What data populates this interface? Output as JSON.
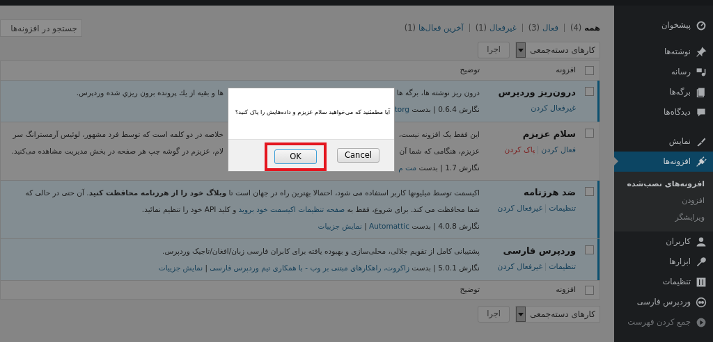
{
  "sidebar": {
    "items": [
      {
        "label": "پیشخوان",
        "selected": false
      },
      {
        "label": "نوشته‌ها",
        "selected": false
      },
      {
        "label": "رسانه",
        "selected": false
      },
      {
        "label": "برگه‌ها",
        "selected": false
      },
      {
        "label": "دیدگاه‌ها",
        "selected": false
      },
      {
        "label": "نمایش",
        "selected": false
      },
      {
        "label": "افزونه‌ها",
        "selected": true,
        "children": [
          {
            "label": "افزونه‌های نصب‌شده",
            "selected": true
          },
          {
            "label": "افزودن",
            "selected": false
          },
          {
            "label": "ویرایشگر",
            "selected": false
          }
        ]
      },
      {
        "label": "کاربران",
        "selected": false
      },
      {
        "label": "ابزارها",
        "selected": false
      },
      {
        "label": "تنظیمات",
        "selected": false
      },
      {
        "label": "وردپرس فارسی",
        "selected": false
      },
      {
        "label": "جمع کردن فهرست",
        "selected": false,
        "kind": "collapse"
      }
    ]
  },
  "filters": [
    {
      "label": "همه",
      "count": "(4)",
      "selected": true
    },
    {
      "label": "فعال",
      "count": "(3)",
      "selected": false
    },
    {
      "label": "غیرفعال",
      "count": "(1)",
      "selected": false
    },
    {
      "label": "آخرین فعال‌ها",
      "count": "(1)",
      "selected": false
    }
  ],
  "search": {
    "placeholder": "جستجو در افزونه‌ها"
  },
  "bulk_top": {
    "select": "کارهای دسته‌جمعی",
    "button": "اجرا"
  },
  "table": {
    "header": {
      "checked": false,
      "columns": [
        "افزونه",
        "توضیح"
      ]
    },
    "rows": [
      {
        "name": "درون‌ریز وردپرس",
        "active": true,
        "checked": false,
        "actions": [
          {
            "label": "غیرفعال کردن",
            "kind": "link"
          }
        ],
        "lines": [
          {
            "segments": [
              {
                "kind": "text",
                "text": "درون ریز نوشته ها، برگه ها"
              }
            ],
            "after_gap": [
              {
                "kind": "text",
                "text": "ها و بقیه از يك پرونده برون ريزي شده وردپرس."
              }
            ]
          },
          {
            "segments": [
              {
                "kind": "text",
                "text": "نگارش 0.6.4 | بدست"
              },
              {
                "kind": "link",
                "text": "torg"
              }
            ]
          }
        ]
      },
      {
        "name": "سلام عزیزم",
        "active": false,
        "checked": false,
        "actions": [
          {
            "label": "فعال کردن",
            "kind": "link"
          },
          {
            "label": "پاک کردن",
            "kind": "danger"
          }
        ],
        "lines": [
          {
            "segments": [
              {
                "kind": "text",
                "text": "این فقط یک افزونه نیست،"
              }
            ],
            "after_gap": [
              {
                "kind": "text",
                "text": "خلاصه در دو کلمه است که توسط فرد مشهور، لوئیس آرمسترانگ سر"
              }
            ]
          },
          {
            "segments": [
              {
                "kind": "text",
                "text": "عزیزم، هنگامی که شما آن"
              }
            ],
            "after_gap": [
              {
                "kind": "text",
                "text": "لام، عزیزم در گوشه چپ هر صفحه در بخش مدیریت مشاهده می‌کنید."
              }
            ]
          },
          {
            "segments": [
              {
                "kind": "text",
                "text": "نگارش 1.7 | بدست"
              },
              {
                "kind": "link",
                "text": "مت م"
              }
            ]
          }
        ]
      },
      {
        "name": "ضد هرزنامه",
        "active": true,
        "checked": false,
        "actions": [
          {
            "label": "تنظیمات",
            "kind": "link"
          },
          {
            "label": "غیرفعال کردن",
            "kind": "link"
          }
        ],
        "lines": [
          {
            "segments": [
              {
                "kind": "text",
                "text": "اکیسمت توسط میلیونها کاربر استفاده می شود، احتمالا بهترین راه در جهان است تا **وبلاگ خود را از هرزنامه محافظت کنید**. آن حتی در حالی که"
              }
            ]
          },
          {
            "segments": [
              {
                "kind": "text",
                "text": "شما محافظت می کند. برای شروع، فقط به"
              },
              {
                "kind": "link",
                "text": "صفحه تنظیمات اکیسمت خود بروید"
              },
              {
                "kind": "text",
                "text": "و کلید API خود را تنظیم نمائید."
              }
            ]
          },
          {
            "segments": [
              {
                "kind": "text",
                "text": "نگارش 4.0.8 | بدست"
              },
              {
                "kind": "link",
                "text": "Automattic"
              },
              {
                "kind": "text",
                "text": "|"
              },
              {
                "kind": "link",
                "text": "نمایش جزییات"
              }
            ]
          }
        ]
      },
      {
        "name": "وردپرس فارسی",
        "active": true,
        "checked": false,
        "actions": [
          {
            "label": "تنظیمات",
            "kind": "link"
          },
          {
            "label": "غیرفعال کردن",
            "kind": "link"
          }
        ],
        "lines": [
          {
            "segments": [
              {
                "kind": "text",
                "text": "پشتیبانی کامل از تقویم جلالی، محلی‌سازی و بهبوده یافته برای کابران فارسی زبان/افغان/تاجیک وردپرس."
              }
            ]
          },
          {
            "segments": [
              {
                "kind": "text",
                "text": "نگارش 5.0.1 | بدست"
              },
              {
                "kind": "link",
                "text": "زاکروت، راهکارهای مبتنی بر وب - با همکاری تیم وردپرس فارسی"
              },
              {
                "kind": "text",
                "text": "|"
              },
              {
                "kind": "link",
                "text": "نمایش جزییات"
              }
            ]
          }
        ]
      }
    ],
    "footer": {
      "checked": false,
      "columns": [
        "افزونه",
        "توضیح"
      ]
    }
  },
  "bulk_bottom": {
    "select": "کارهای دسته‌جمعی",
    "button": "اجرا"
  },
  "dialog": {
    "message": "آیا مطمئنید که می‌خواهید سلام عزیزم و داده‌هایش را پاک کنید؟",
    "buttons": [
      {
        "label": "Cancel",
        "kind": "cancel",
        "highlighted": false
      },
      {
        "label": "OK",
        "kind": "ok",
        "highlighted": true
      }
    ]
  }
}
